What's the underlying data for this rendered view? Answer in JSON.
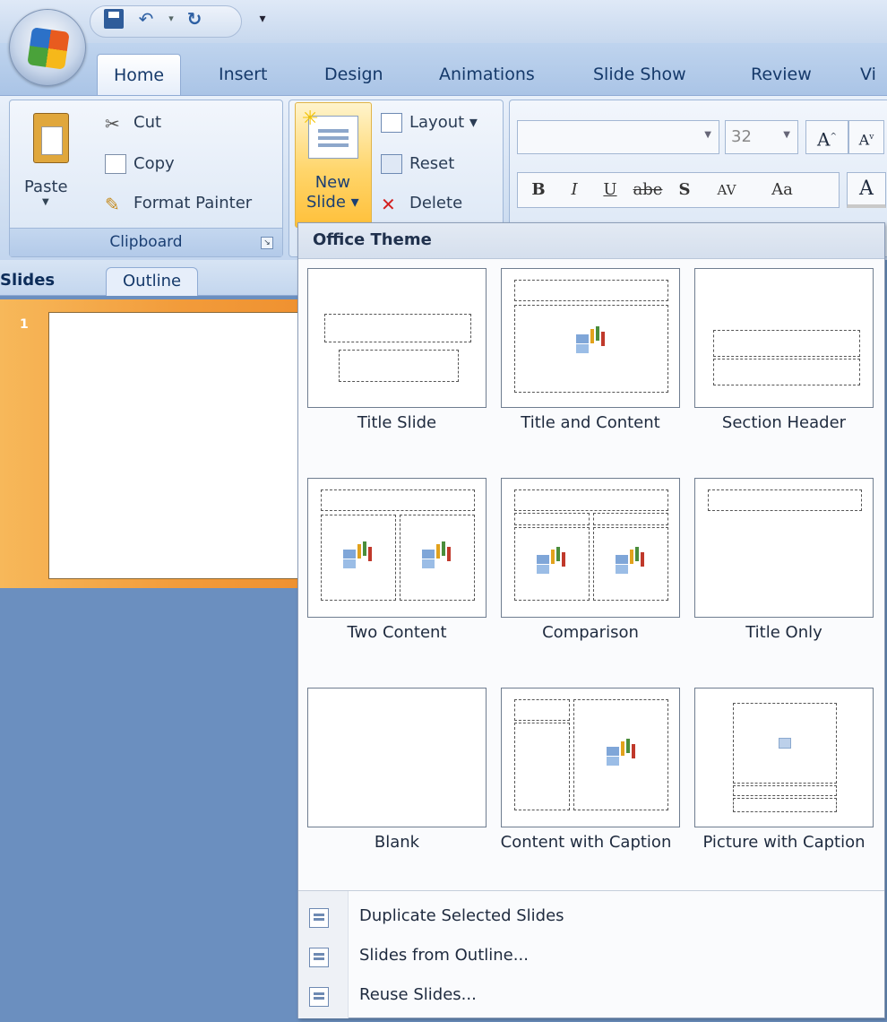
{
  "qat": {
    "save_icon": "save-icon",
    "undo_icon": "undo-icon",
    "redo_icon": "redo-icon"
  },
  "tabs": [
    "Home",
    "Insert",
    "Design",
    "Animations",
    "Slide Show",
    "Review",
    "Vi"
  ],
  "clipboard": {
    "paste": "Paste",
    "cut": "Cut",
    "copy": "Copy",
    "format_painter": "Format Painter",
    "label": "Clipboard"
  },
  "slides_group": {
    "new_slide_line1": "New",
    "new_slide_line2": "Slide ▾",
    "layout": "Layout ▾",
    "reset": "Reset",
    "delete": "Delete"
  },
  "font": {
    "size": "32",
    "bold": "B",
    "italic": "I",
    "underline": "U",
    "strike": "abe",
    "shadow": "S",
    "spacing": "AV",
    "case": "Aa"
  },
  "pane": {
    "slides_tab": "Slides",
    "outline_tab": "Outline",
    "slide_number": "1"
  },
  "gallery": {
    "header": "Office Theme",
    "layouts": [
      {
        "label": "Title Slide"
      },
      {
        "label": "Title and Content"
      },
      {
        "label": "Section Header"
      },
      {
        "label": "Two Content"
      },
      {
        "label": "Comparison"
      },
      {
        "label": "Title Only"
      },
      {
        "label": "Blank"
      },
      {
        "label": "Content with Caption"
      },
      {
        "label": "Picture with Caption"
      }
    ],
    "menu": [
      {
        "label": "Duplicate Selected Slides"
      },
      {
        "label": "Slides from Outline..."
      },
      {
        "label": "Reuse Slides..."
      }
    ]
  }
}
